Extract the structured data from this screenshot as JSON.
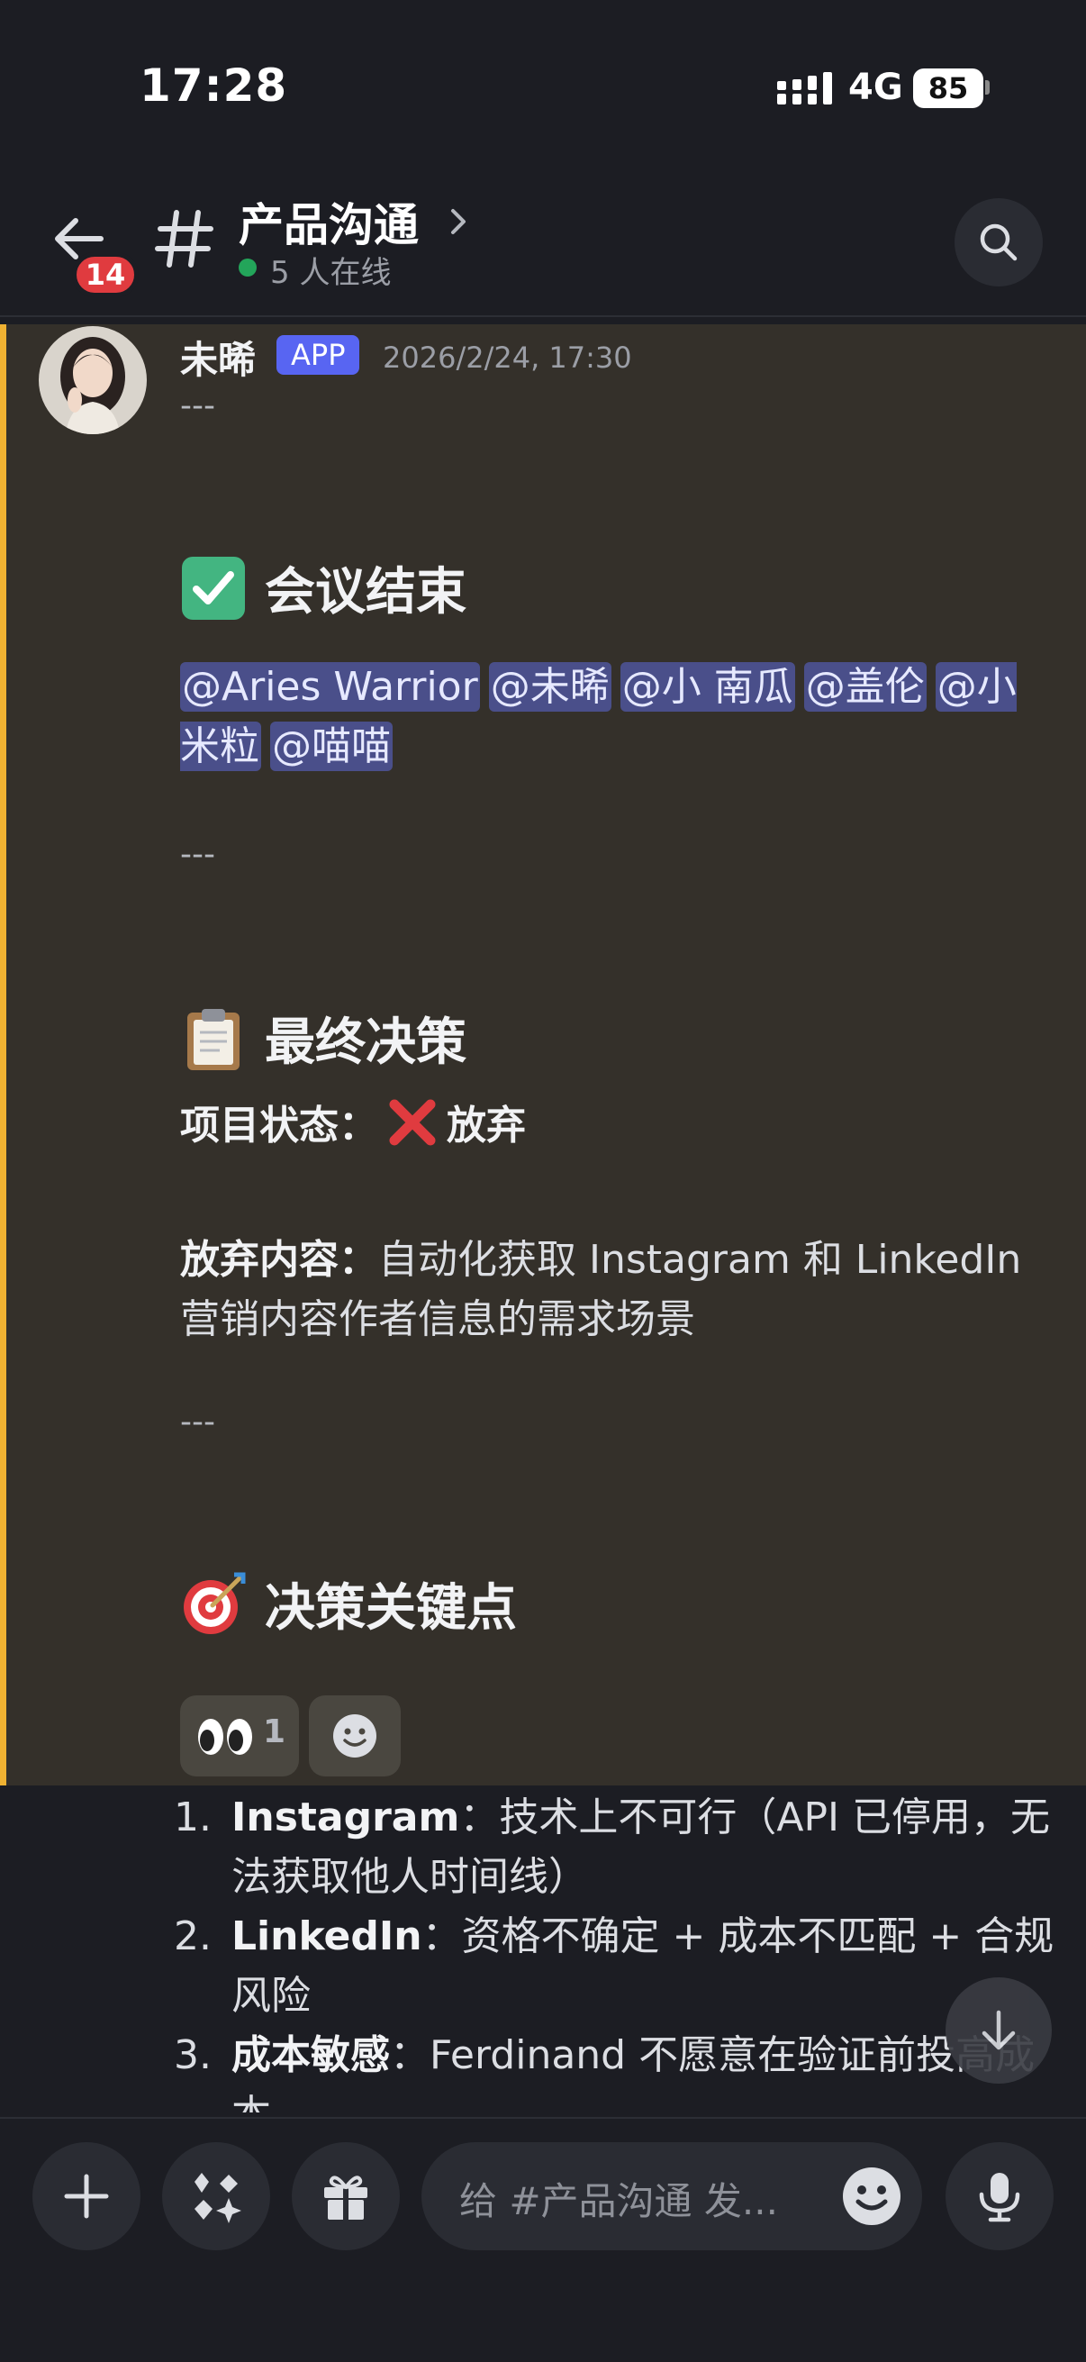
{
  "status_bar": {
    "time": "17:28",
    "network": "4G",
    "battery": "85"
  },
  "header": {
    "unread_count": "14",
    "channel_name": "产品沟通",
    "online_text": "5 人在线"
  },
  "message": {
    "author": "未晞",
    "badge": "APP",
    "timestamp": "2026/2/24, 17:30",
    "divider1": "---",
    "heading1": "会议结束",
    "mentions": [
      "@Aries Warrior",
      "@未晞",
      "@小 南瓜",
      "@盖伦",
      "@小米粒",
      "@喵喵"
    ],
    "divider2": "---",
    "heading2": "最终决策",
    "status_label": "项目状态：",
    "status_value": "放弃",
    "abandon_label": "放弃内容：",
    "abandon_value": "自动化获取 Instagram 和 LinkedIn 营销内容作者信息的需求场景",
    "divider3": "---",
    "heading3": "决策关键点",
    "reactions": [
      {
        "emoji": "eyes",
        "count": "1"
      }
    ]
  },
  "list": [
    {
      "num": "1.",
      "label": "Instagram",
      "text": "：技术上不可行（API 已停用，无法获取他人时间线）"
    },
    {
      "num": "2.",
      "label": "LinkedIn",
      "text": "：资格不确定 + 成本不匹配 + 合规风险"
    },
    {
      "num": "3.",
      "label": "成本敏感",
      "text": "：Ferdinand 不愿意在验证前投高成本"
    }
  ],
  "composer": {
    "placeholder": "给 #产品沟通 发..."
  },
  "colors": {
    "accent_bar": "#f0b232",
    "mention_bg": "#4a4f8a",
    "badge": "#5865f2",
    "online": "#23a55a",
    "unread": "#e03b3f"
  }
}
